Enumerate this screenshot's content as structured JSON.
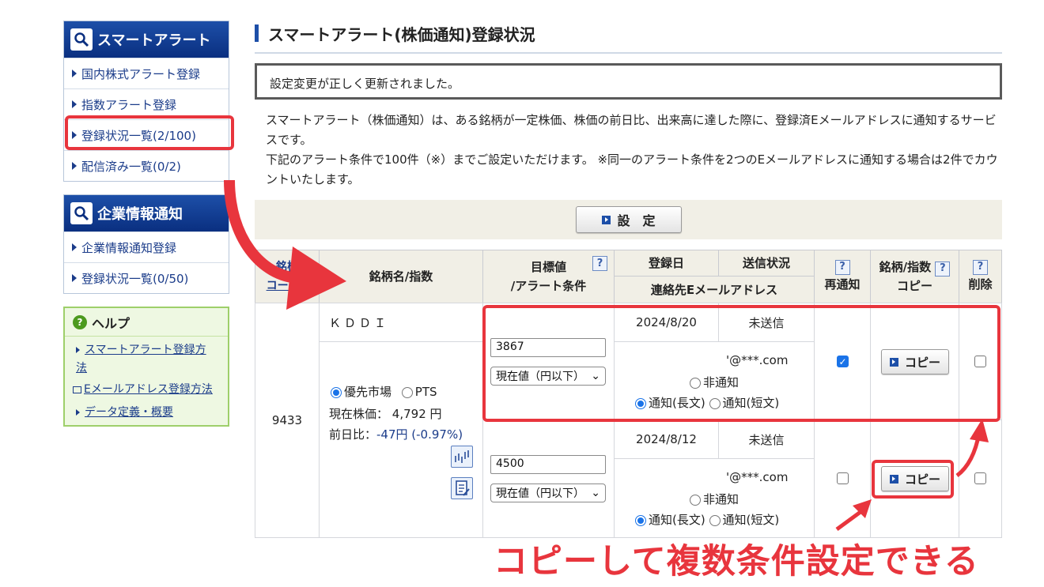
{
  "sidebar": {
    "smart_alert": {
      "title": "スマートアラート",
      "items": [
        {
          "label": "国内株式アラート登録"
        },
        {
          "label": "指数アラート登録"
        },
        {
          "label": "登録状況一覧(2/100)"
        },
        {
          "label": "配信済み一覧(0/2)"
        }
      ]
    },
    "company_info": {
      "title": "企業情報通知",
      "items": [
        {
          "label": "企業情報通知登録"
        },
        {
          "label": "登録状況一覧(0/50)"
        }
      ]
    },
    "help": {
      "title": "ヘルプ",
      "links": [
        {
          "label": "スマートアラート登録方法"
        },
        {
          "label": "Eメールアドレス登録方法"
        },
        {
          "label": "データ定義・概要"
        }
      ]
    }
  },
  "page": {
    "title": "スマートアラート(株価通知)登録状況",
    "message": "設定変更が正しく更新されました。",
    "desc1": "スマートアラート（株価通知）は、ある銘柄が一定株価、株価の前日比、出来高に達した際に、登録済Eメールアドレスに通知するサービスです。",
    "desc2": "下記のアラート条件で100件（※）までご設定いただけます。 ※同一のアラート条件を2つのEメールアドレスに通知する場合は2件でカウントいたします。",
    "set_button": "設　定"
  },
  "table": {
    "headers": {
      "code_line1": "銘柄",
      "code_line2": "コード▲",
      "name": "銘柄名/指数",
      "target_line1": "目標値",
      "target_line2": "/アラート条件",
      "reg_date": "登録日",
      "send_status": "送信状況",
      "email": "連絡先Eメールアドレス",
      "renotify": "再通知",
      "copy_line1": "銘柄/指数",
      "copy_line2": "コピー",
      "delete": "削除",
      "q": "?"
    },
    "stock": {
      "code": "9433",
      "name": "ＫＤＤＩ",
      "market_primary": "優先市場",
      "market_pts": "PTS",
      "price_label": "現在株価：",
      "price_value": "4,792 円",
      "change_label": "前日比：",
      "change_value": "-47円",
      "change_pct": "(-0.97%)"
    },
    "rows": [
      {
        "target": "3867",
        "condition": "現在値（円以下）",
        "reg_date": "2024/8/20",
        "status": "未送信",
        "email": "'@***.com",
        "opt_none": "非通知",
        "opt_long": "通知(長文)",
        "opt_short": "通知(短文)",
        "renotify": true,
        "copy_button": "コピー",
        "delete": false
      },
      {
        "target": "4500",
        "condition": "現在値（円以下）",
        "reg_date": "2024/8/12",
        "status": "未送信",
        "email": "'@***.com",
        "opt_none": "非通知",
        "opt_long": "通知(長文)",
        "opt_short": "通知(短文)",
        "renotify": false,
        "copy_button": "コピー",
        "delete": false
      }
    ]
  },
  "annotation": {
    "caption": "コピーして複数条件設定できる",
    "accent": "#e8353d"
  }
}
